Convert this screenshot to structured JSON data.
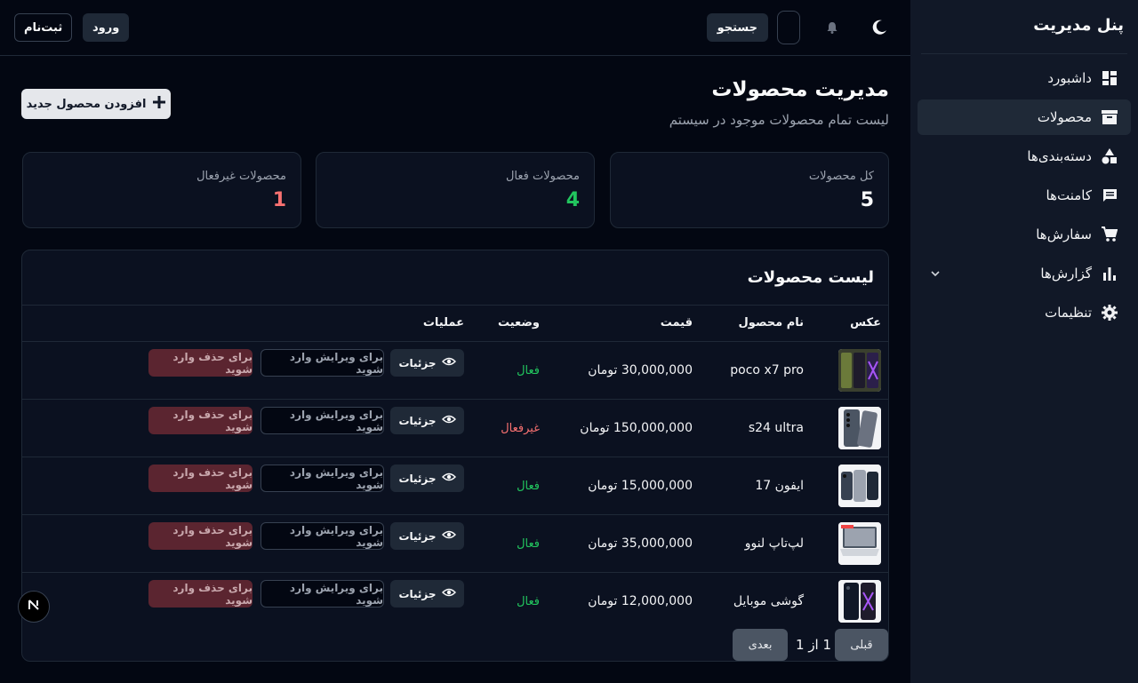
{
  "sidebar": {
    "title": "پنل مدیریت",
    "items": [
      {
        "label": "داشبورد",
        "icon": "dashboard-icon"
      },
      {
        "label": "محصولات",
        "icon": "box-icon",
        "active": true
      },
      {
        "label": "دسته‌بندی‌ها",
        "icon": "shapes-icon"
      },
      {
        "label": "کامنت‌ها",
        "icon": "comment-icon"
      },
      {
        "label": "سفارش‌ها",
        "icon": "cart-icon"
      },
      {
        "label": "گزارش‌ها",
        "icon": "bar-chart-icon",
        "expandable": true
      },
      {
        "label": "تنظیمات",
        "icon": "gear-icon"
      }
    ]
  },
  "topbar": {
    "search_label": "جستجو",
    "login_label": "ورود",
    "register_label": "ثبت‌نام"
  },
  "page": {
    "title": "مدیریت محصولات",
    "subtitle": "لیست تمام محصولات موجود در سیستم",
    "add_button": "افزودن محصول جدید"
  },
  "stats": [
    {
      "label": "کل محصولات",
      "value": "5",
      "color": "#f9fafb"
    },
    {
      "label": "محصولات فعال",
      "value": "4",
      "color": "#22c55e"
    },
    {
      "label": "محصولات غیرفعال",
      "value": "1",
      "color": "#f87171"
    }
  ],
  "table": {
    "title": "لیست محصولات",
    "headers": {
      "image": "عکس",
      "name": "نام محصول",
      "price": "قیمت",
      "status": "وضعیت",
      "actions": "عملیات"
    },
    "details_label": "جزئیات",
    "edit_label": "برای ویرایش وارد شوید",
    "delete_label": "برای حذف وارد شوید",
    "rows": [
      {
        "name": "poco x7 pro",
        "price": "30,000,000 تومان",
        "status": "فعال",
        "status_color": "#22c55e"
      },
      {
        "name": "s24 ultra",
        "price": "150,000,000 تومان",
        "status": "غیرفعال",
        "status_color": "#f87171"
      },
      {
        "name": "ایفون 17",
        "price": "15,000,000 تومان",
        "status": "فعال",
        "status_color": "#22c55e"
      },
      {
        "name": "لپ‌تاپ لنوو",
        "price": "35,000,000 تومان",
        "status": "فعال",
        "status_color": "#22c55e"
      },
      {
        "name": "گوشی موبایل",
        "price": "12,000,000 تومان",
        "status": "فعال",
        "status_color": "#22c55e"
      }
    ]
  },
  "pagination": {
    "prev": "قبلی",
    "info": "1 از 1",
    "next": "بعدی"
  },
  "colors": {
    "accent_active": "#22c55e",
    "accent_inactive": "#f87171",
    "background": "#030712"
  }
}
